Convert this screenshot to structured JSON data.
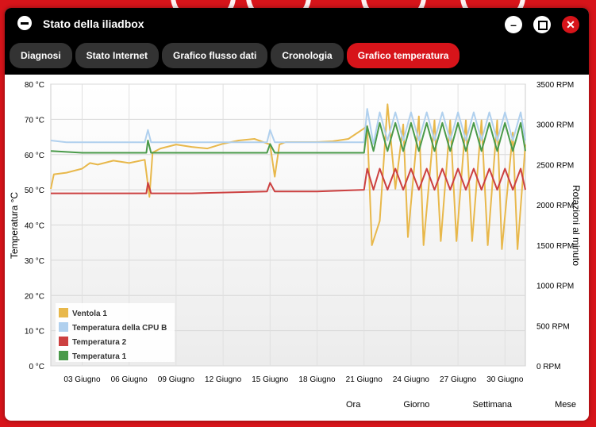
{
  "window": {
    "title": "Stato della iliadbox"
  },
  "tabs": [
    {
      "label": "Diagnosi"
    },
    {
      "label": "Stato Internet"
    },
    {
      "label": "Grafico flusso dati"
    },
    {
      "label": "Cronologia"
    },
    {
      "label": "Grafico temperatura",
      "active": true
    }
  ],
  "ranges": [
    {
      "label": "Ora"
    },
    {
      "label": "Giorno"
    },
    {
      "label": "Settimana"
    },
    {
      "label": "Mese"
    }
  ],
  "chart_data": {
    "type": "line",
    "ylabel": "Temperatura °C",
    "y2label": "Rotazioni al minuto",
    "ylim": [
      0,
      80
    ],
    "y2lim": [
      0,
      3500
    ],
    "yticks": [
      "0 °C",
      "10 °C",
      "20 °C",
      "30 °C",
      "40 °C",
      "50 °C",
      "60 °C",
      "70 °C",
      "80 °C"
    ],
    "y2ticks": [
      "0 RPM",
      "500 RPM",
      "1000 RPM",
      "1500 RPM",
      "2000 RPM",
      "2500 RPM",
      "3000 RPM",
      "3500 RPM"
    ],
    "xlim": [
      1,
      31.3
    ],
    "xticks": [
      {
        "day": 3,
        "label": "03 Giugno"
      },
      {
        "day": 6,
        "label": "06 Giugno"
      },
      {
        "day": 9,
        "label": "09 Giugno"
      },
      {
        "day": 12,
        "label": "12 Giugno"
      },
      {
        "day": 15,
        "label": "15 Giugno"
      },
      {
        "day": 18,
        "label": "18 Giugno"
      },
      {
        "day": 21,
        "label": "21 Giugno"
      },
      {
        "day": 24,
        "label": "24 Giugno"
      },
      {
        "day": 27,
        "label": "27 Giugno"
      },
      {
        "day": 30,
        "label": "30 Giugno"
      }
    ],
    "legend_position": "bottom-left",
    "series": [
      {
        "name": "Ventola 1",
        "color": "#e8b84b",
        "axis": "rpm",
        "points": [
          [
            1,
            2200
          ],
          [
            1.2,
            2380
          ],
          [
            2,
            2400
          ],
          [
            3,
            2450
          ],
          [
            3.5,
            2520
          ],
          [
            4,
            2500
          ],
          [
            5,
            2550
          ],
          [
            6,
            2520
          ],
          [
            7,
            2560
          ],
          [
            7.3,
            2100
          ],
          [
            7.5,
            2650
          ],
          [
            8,
            2700
          ],
          [
            9,
            2750
          ],
          [
            10,
            2720
          ],
          [
            11,
            2700
          ],
          [
            12,
            2760
          ],
          [
            13,
            2800
          ],
          [
            14,
            2820
          ],
          [
            15,
            2750
          ],
          [
            15.3,
            2350
          ],
          [
            15.6,
            2750
          ],
          [
            16,
            2780
          ],
          [
            17,
            2780
          ],
          [
            18,
            2780
          ],
          [
            19,
            2790
          ],
          [
            20,
            2820
          ],
          [
            21,
            2950
          ],
          [
            21.2,
            2980
          ],
          [
            21.5,
            1500
          ],
          [
            22,
            1800
          ],
          [
            22.5,
            3250
          ],
          [
            23,
            2200
          ],
          [
            23.5,
            3000
          ],
          [
            23.8,
            1600
          ],
          [
            24.5,
            3100
          ],
          [
            24.8,
            1500
          ],
          [
            25.5,
            3050
          ],
          [
            25.9,
            1550
          ],
          [
            26.5,
            3050
          ],
          [
            26.9,
            1550
          ],
          [
            27.5,
            3050
          ],
          [
            27.9,
            1550
          ],
          [
            28.5,
            3050
          ],
          [
            28.9,
            1500
          ],
          [
            29.5,
            3050
          ],
          [
            29.8,
            1450
          ],
          [
            30.5,
            2900
          ],
          [
            30.8,
            1450
          ],
          [
            31.3,
            2750
          ]
        ]
      },
      {
        "name": "Temperatura della CPU B",
        "color": "#b0d0ee",
        "axis": "temp",
        "points": [
          [
            1,
            64
          ],
          [
            2,
            63.5
          ],
          [
            4,
            63.5
          ],
          [
            6,
            63.5
          ],
          [
            7,
            63.5
          ],
          [
            7.2,
            67
          ],
          [
            7.4,
            63.5
          ],
          [
            10,
            63.5
          ],
          [
            13,
            63.5
          ],
          [
            14.8,
            63.5
          ],
          [
            15,
            67
          ],
          [
            15.3,
            63.5
          ],
          [
            18,
            63.5
          ],
          [
            21,
            63.5
          ],
          [
            21.2,
            73
          ],
          [
            21.6,
            63
          ],
          [
            22,
            72
          ],
          [
            22.5,
            64
          ],
          [
            23,
            72
          ],
          [
            23.5,
            64
          ],
          [
            24,
            72
          ],
          [
            24.5,
            64
          ],
          [
            25,
            72
          ],
          [
            25.5,
            64
          ],
          [
            26,
            72
          ],
          [
            26.5,
            64
          ],
          [
            27,
            72
          ],
          [
            27.5,
            64
          ],
          [
            28,
            72
          ],
          [
            28.5,
            64
          ],
          [
            29,
            72
          ],
          [
            29.5,
            64
          ],
          [
            30,
            72
          ],
          [
            30.5,
            64
          ],
          [
            31,
            72
          ],
          [
            31.3,
            64
          ]
        ]
      },
      {
        "name": "Temperatura 2",
        "color": "#cc4040",
        "axis": "temp",
        "points": [
          [
            1,
            49
          ],
          [
            3,
            49
          ],
          [
            6,
            49
          ],
          [
            7.1,
            49
          ],
          [
            7.2,
            52
          ],
          [
            7.4,
            49
          ],
          [
            10,
            49
          ],
          [
            14.8,
            49.5
          ],
          [
            15,
            52
          ],
          [
            15.3,
            49.5
          ],
          [
            18,
            49.5
          ],
          [
            21,
            50
          ],
          [
            21.2,
            56
          ],
          [
            21.6,
            50
          ],
          [
            22,
            56
          ],
          [
            22.5,
            50
          ],
          [
            23,
            56
          ],
          [
            23.5,
            50
          ],
          [
            24,
            56
          ],
          [
            24.5,
            50
          ],
          [
            25,
            56
          ],
          [
            25.5,
            50
          ],
          [
            26,
            56
          ],
          [
            26.5,
            50
          ],
          [
            27,
            56
          ],
          [
            27.5,
            50
          ],
          [
            28,
            56
          ],
          [
            28.5,
            50
          ],
          [
            29,
            56
          ],
          [
            29.5,
            50
          ],
          [
            30,
            56
          ],
          [
            30.5,
            50
          ],
          [
            31,
            56
          ],
          [
            31.3,
            50
          ]
        ]
      },
      {
        "name": "Temperatura 1",
        "color": "#4a9a4a",
        "axis": "temp",
        "points": [
          [
            1,
            61
          ],
          [
            3,
            60.5
          ],
          [
            6,
            60.5
          ],
          [
            7.1,
            60.5
          ],
          [
            7.2,
            64
          ],
          [
            7.4,
            60.5
          ],
          [
            10,
            60.5
          ],
          [
            14.8,
            60.5
          ],
          [
            15,
            63
          ],
          [
            15.3,
            60.5
          ],
          [
            18,
            60.5
          ],
          [
            21,
            60.5
          ],
          [
            21.2,
            68
          ],
          [
            21.6,
            61
          ],
          [
            22,
            69
          ],
          [
            22.5,
            61
          ],
          [
            23,
            69
          ],
          [
            23.5,
            61
          ],
          [
            24,
            69
          ],
          [
            24.5,
            61
          ],
          [
            25,
            69
          ],
          [
            25.5,
            61
          ],
          [
            26,
            69
          ],
          [
            26.5,
            61
          ],
          [
            27,
            69
          ],
          [
            27.5,
            61
          ],
          [
            28,
            69
          ],
          [
            28.5,
            61
          ],
          [
            29,
            69
          ],
          [
            29.5,
            61
          ],
          [
            30,
            69
          ],
          [
            30.5,
            61
          ],
          [
            31,
            69
          ],
          [
            31.3,
            61
          ]
        ]
      }
    ]
  }
}
